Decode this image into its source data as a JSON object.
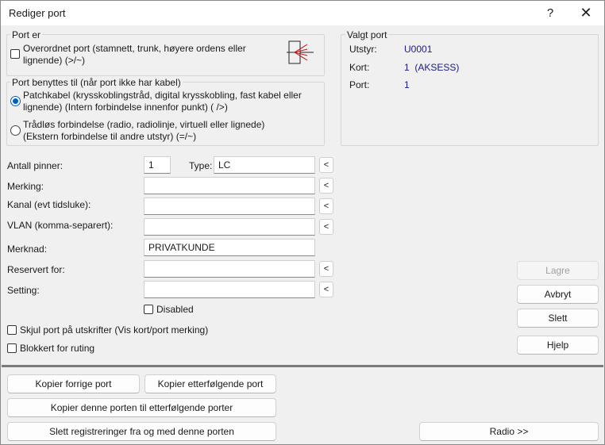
{
  "window": {
    "title": "Rediger port",
    "help": "?",
    "close": "✕"
  },
  "port_er": {
    "title": "Port er",
    "overordnet_label": "Overordnet port (stamnett, trunk, høyere ordens eller lignende) (>/~)",
    "overordnet_checked": false,
    "icon": "port-split-icon"
  },
  "port_benyttes": {
    "title": "Port benyttes til (når port ikke har kabel)",
    "options": [
      {
        "label": "Patchkabel (krysskoblingstråd, digital krysskobling, fast kabel eller lignende) (Intern forbindelse innenfor punkt) ( />)",
        "selected": true
      },
      {
        "label": "Trådløs forbindelse (radio, radiolinje, virtuell eller lignede) (Ekstern forbindelse til andre utstyr) (=/~)",
        "selected": false
      }
    ]
  },
  "valgt_port": {
    "title": "Valgt port",
    "utstyr_label": "Utstyr:",
    "utstyr_value": "U0001",
    "kort_label": "Kort:",
    "kort_value": "1  (AKSESS)",
    "port_label": "Port:",
    "port_value": "1"
  },
  "form": {
    "antall_pinner_label": "Antall pinner:",
    "antall_pinner_value": "1",
    "type_label": "Type:",
    "type_value": "LC",
    "merking_label": "Merking:",
    "merking_value": "",
    "kanal_label": "Kanal (evt tidsluke):",
    "kanal_value": "",
    "vlan_label": "VLAN (komma-separert):",
    "vlan_value": "",
    "merknad_label": "Merknad:",
    "merknad_value": "PRIVATKUNDE",
    "reservert_label": "Reservert for:",
    "reservert_value": "",
    "setting_label": "Setting:",
    "setting_value": "",
    "disabled_label": "Disabled",
    "disabled_checked": false,
    "skjul_label": "Skjul port på utskrifter (Vis kort/port merking)",
    "skjul_checked": false,
    "blokkert_label": "Blokkert for ruting",
    "blokkert_checked": false,
    "pick_label": "<"
  },
  "actions": {
    "lagre": "Lagre",
    "avbryt": "Avbryt",
    "slett": "Slett",
    "hjelp": "Hjelp"
  },
  "bottom": {
    "kopier_forrige": "Kopier forrige port",
    "kopier_etterfolgende": "Kopier etterfølgende port",
    "kopier_denne": "Kopier denne porten til etterfølgende porter",
    "slett_registreringer": "Slett registreringer fra og med denne porten",
    "radio": "Radio >>"
  }
}
